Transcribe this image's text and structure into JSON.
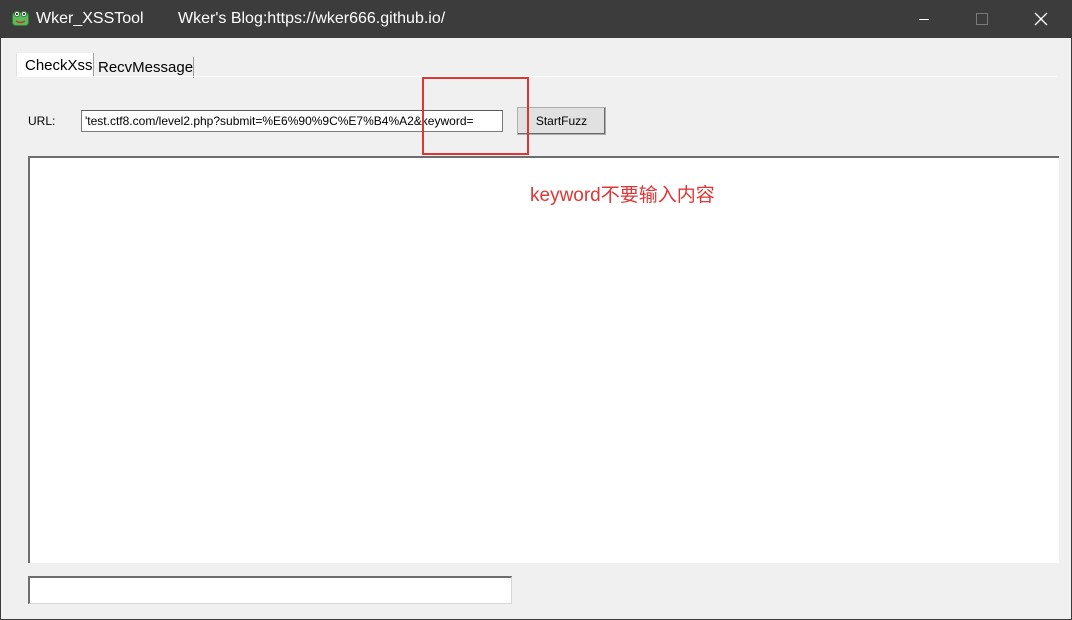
{
  "window": {
    "app_title": "Wker_XSSTool",
    "blog_title": "Wker's Blog:https://wker666.github.io/",
    "app_icon": "frog-app-icon",
    "controls": {
      "minimize": "minimize-icon",
      "maximize": "maximize-icon",
      "close": "close-icon"
    }
  },
  "tabs": [
    {
      "label": "CheckXss",
      "selected": true
    },
    {
      "label": "RecvMessage",
      "selected": false
    }
  ],
  "form": {
    "url_label": "URL:",
    "url_value": "'test.ctf8.com/level2.php?submit=%E6%90%9C%E7%B4%A2&keyword=",
    "start_button_label": "StartFuzz"
  },
  "output": {
    "text": ""
  },
  "annotation": {
    "text": "keyword不要输入内容",
    "color": "#e03535"
  },
  "bottom_field": {
    "value": ""
  },
  "colors": {
    "titlebar": "#3c3c3c",
    "window_bg": "#f0f0f0",
    "highlight": "#e03535"
  }
}
